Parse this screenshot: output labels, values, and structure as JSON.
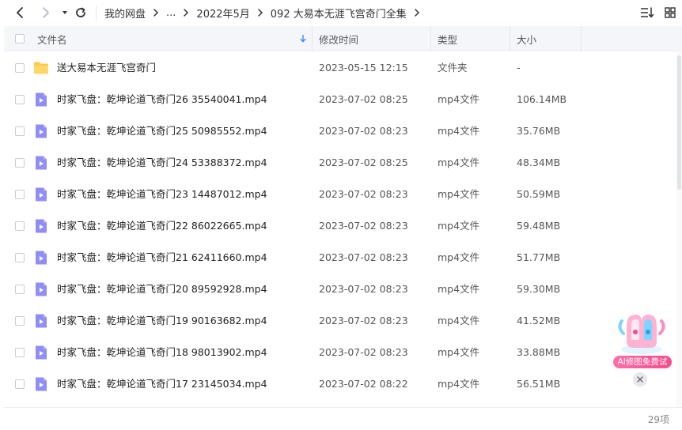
{
  "breadcrumb": {
    "items": [
      "我的网盘",
      "...",
      "2022年5月",
      "092 大易本无涯飞宫奇门全集"
    ]
  },
  "header": {
    "name": "文件名",
    "modified": "修改时间",
    "type": "类型",
    "size": "大小"
  },
  "files": [
    {
      "name": "送大易本无涯飞宫奇门",
      "date": "2023-05-15 12:15",
      "type": "文件夹",
      "size": "-",
      "kind": "folder-icon"
    },
    {
      "name": "时家飞盘：乾坤论道飞奇门26 35540041.mp4",
      "date": "2023-07-02 08:25",
      "type": "mp4文件",
      "size": "106.14MB",
      "kind": "video-file-icon"
    },
    {
      "name": "时家飞盘：乾坤论道飞奇门25 50985552.mp4",
      "date": "2023-07-02 08:23",
      "type": "mp4文件",
      "size": "35.76MB",
      "kind": "video-file-icon"
    },
    {
      "name": "时家飞盘：乾坤论道飞奇门24 53388372.mp4",
      "date": "2023-07-02 08:25",
      "type": "mp4文件",
      "size": "48.34MB",
      "kind": "video-file-icon"
    },
    {
      "name": "时家飞盘：乾坤论道飞奇门23 14487012.mp4",
      "date": "2023-07-02 08:23",
      "type": "mp4文件",
      "size": "50.59MB",
      "kind": "video-file-icon"
    },
    {
      "name": "时家飞盘：乾坤论道飞奇门22 86022665.mp4",
      "date": "2023-07-02 08:23",
      "type": "mp4文件",
      "size": "59.48MB",
      "kind": "video-file-icon"
    },
    {
      "name": "时家飞盘：乾坤论道飞奇门21 62411660.mp4",
      "date": "2023-07-02 08:23",
      "type": "mp4文件",
      "size": "51.77MB",
      "kind": "video-file-icon"
    },
    {
      "name": "时家飞盘：乾坤论道飞奇门20  89592928.mp4",
      "date": "2023-07-02 08:23",
      "type": "mp4文件",
      "size": "59.30MB",
      "kind": "video-file-icon"
    },
    {
      "name": "时家飞盘：乾坤论道飞奇门19  90163682.mp4",
      "date": "2023-07-02 08:23",
      "type": "mp4文件",
      "size": "41.52MB",
      "kind": "video-file-icon"
    },
    {
      "name": "时家飞盘：乾坤论道飞奇门18  98013902.mp4",
      "date": "2023-07-02 08:23",
      "type": "mp4文件",
      "size": "33.88MB",
      "kind": "video-file-icon"
    },
    {
      "name": "时家飞盘：乾坤论道飞奇门17  23145034.mp4",
      "date": "2023-07-02 08:22",
      "type": "mp4文件",
      "size": "56.51MB",
      "kind": "video-file-icon"
    }
  ],
  "footer": {
    "count": "29项"
  },
  "ai_badge": {
    "label": "AI修图免费试"
  },
  "colors": {
    "folder": "#ffc94a",
    "video": "#8f8df6",
    "sort_accent": "#3b8cff",
    "ai_pink": "#f74b8d"
  }
}
